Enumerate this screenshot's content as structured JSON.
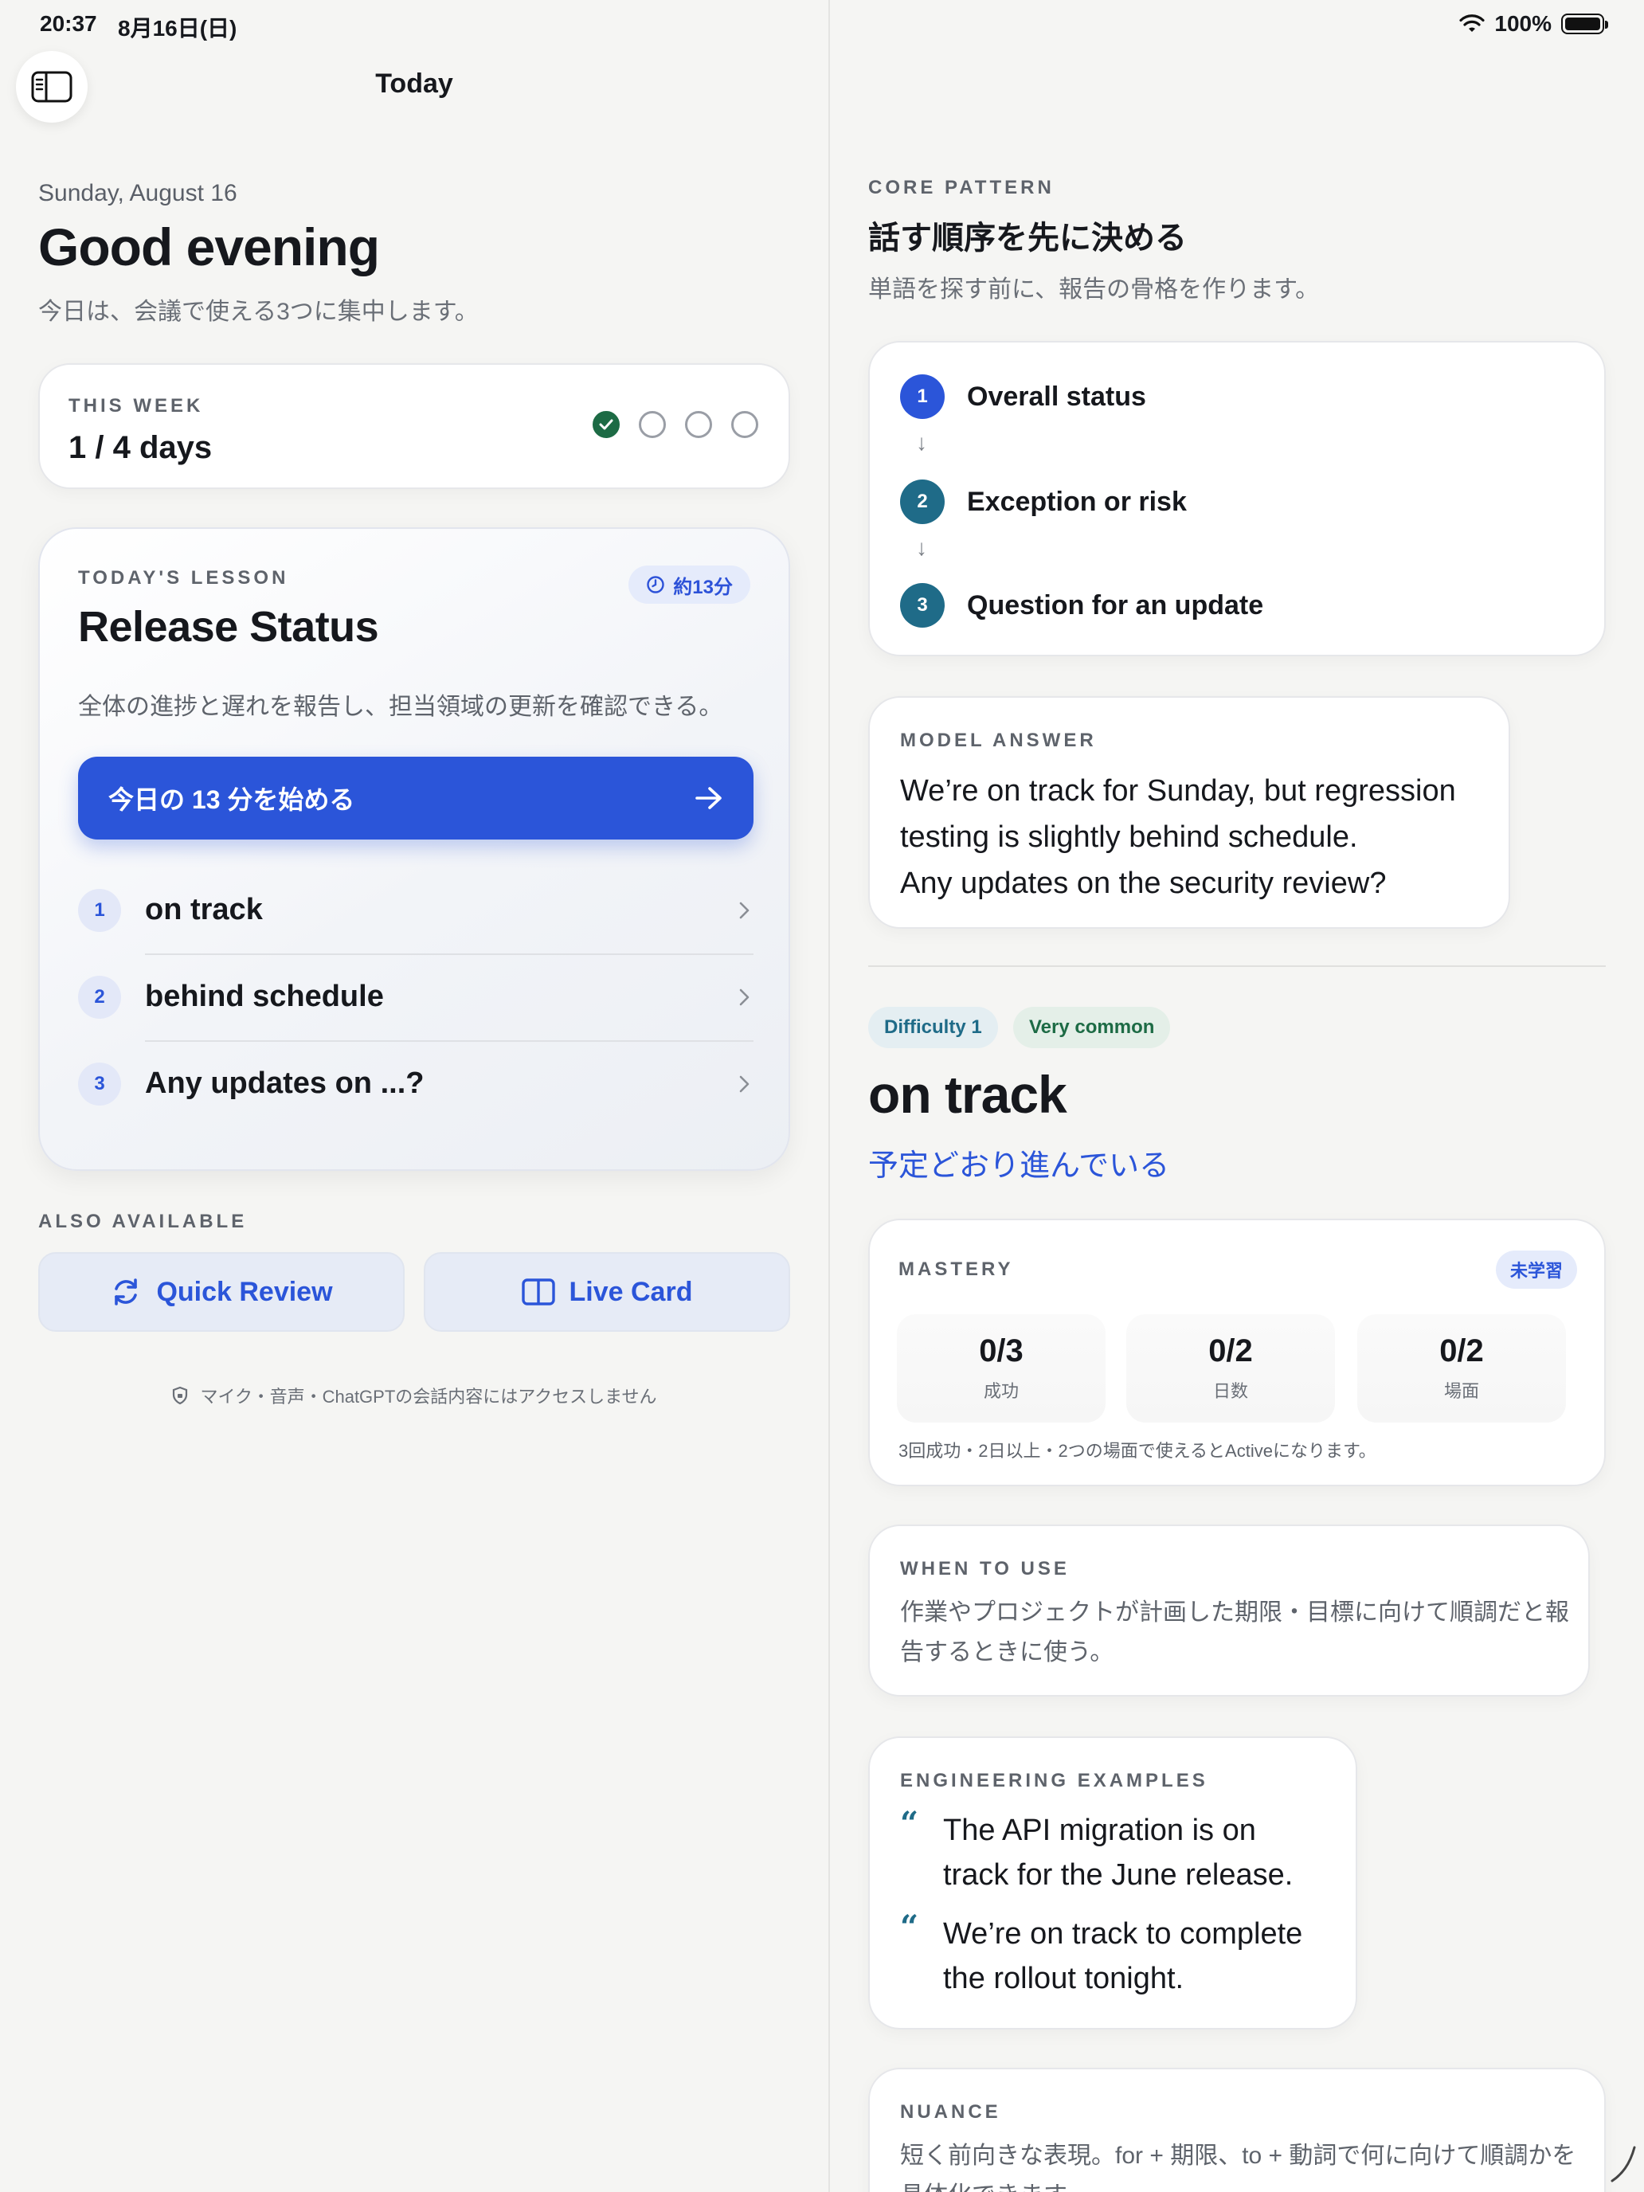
{
  "status_bar": {
    "time": "20:37",
    "date": "8月16日(日)",
    "battery": "100%"
  },
  "nav": {
    "title": "Today"
  },
  "greeting": {
    "date": "Sunday, August 16",
    "title": "Good evening",
    "subtitle": "今日は、会議で使える3つに集中します。"
  },
  "week": {
    "label": "THIS WEEK",
    "value": "1 / 4 days",
    "days_completed": 1,
    "days_total": 4
  },
  "lesson": {
    "label": "TODAY'S LESSON",
    "duration": "約13分",
    "title": "Release Status",
    "description": "全体の進捗と遅れを報告し、担当領域の更新を確認できる。",
    "start_label": "今日の 13 分を始める",
    "phrases": [
      {
        "num": "1",
        "text": "on track"
      },
      {
        "num": "2",
        "text": "behind schedule"
      },
      {
        "num": "3",
        "text": "Any updates on ...?"
      }
    ]
  },
  "also": {
    "label": "ALSO AVAILABLE",
    "quick_review": "Quick Review",
    "live_card": "Live Card"
  },
  "privacy_note": "マイク・音声・ChatGPTの会話内容にはアクセスしません",
  "core": {
    "label": "CORE PATTERN",
    "title": "話す順序を先に決める",
    "subtitle": "単語を探す前に、報告の骨格を作ります。",
    "steps": [
      {
        "num": "1",
        "text": "Overall status"
      },
      {
        "num": "2",
        "text": "Exception or risk"
      },
      {
        "num": "3",
        "text": "Question for an update"
      }
    ]
  },
  "model_answer": {
    "label": "MODEL ANSWER",
    "line1": "We’re on track for Sunday, but regression",
    "line2": "testing is slightly behind schedule.",
    "line3": "Any updates on the security review?"
  },
  "phrase_detail": {
    "difficulty": "Difficulty 1",
    "frequency": "Very common",
    "title": "on track",
    "meaning": "予定どおり進んでいる"
  },
  "mastery": {
    "label": "MASTERY",
    "badge": "未学習",
    "stats": [
      {
        "value": "0/3",
        "label": "成功"
      },
      {
        "value": "0/2",
        "label": "日数"
      },
      {
        "value": "0/2",
        "label": "場面"
      }
    ],
    "note": "3回成功・2日以上・2つの場面で使えるとActiveになります。"
  },
  "when_to_use": {
    "label": "WHEN TO USE",
    "text": "作業やプロジェクトが計画した期限・目標に向けて順調だと報告するときに使う。"
  },
  "examples": {
    "label": "ENGINEERING EXAMPLES",
    "items": [
      "The API migration is on track for the June release.",
      "We’re on track to complete the rollout tonight."
    ]
  },
  "nuance": {
    "label": "NUANCE",
    "text": "短く前向きな表現。for + 期限、to + 動詞で何に向けて順調かを具体化できます。"
  },
  "colors": {
    "accent": "#2b55d9",
    "success": "#1d6b45",
    "teal": "#1f6b88"
  }
}
